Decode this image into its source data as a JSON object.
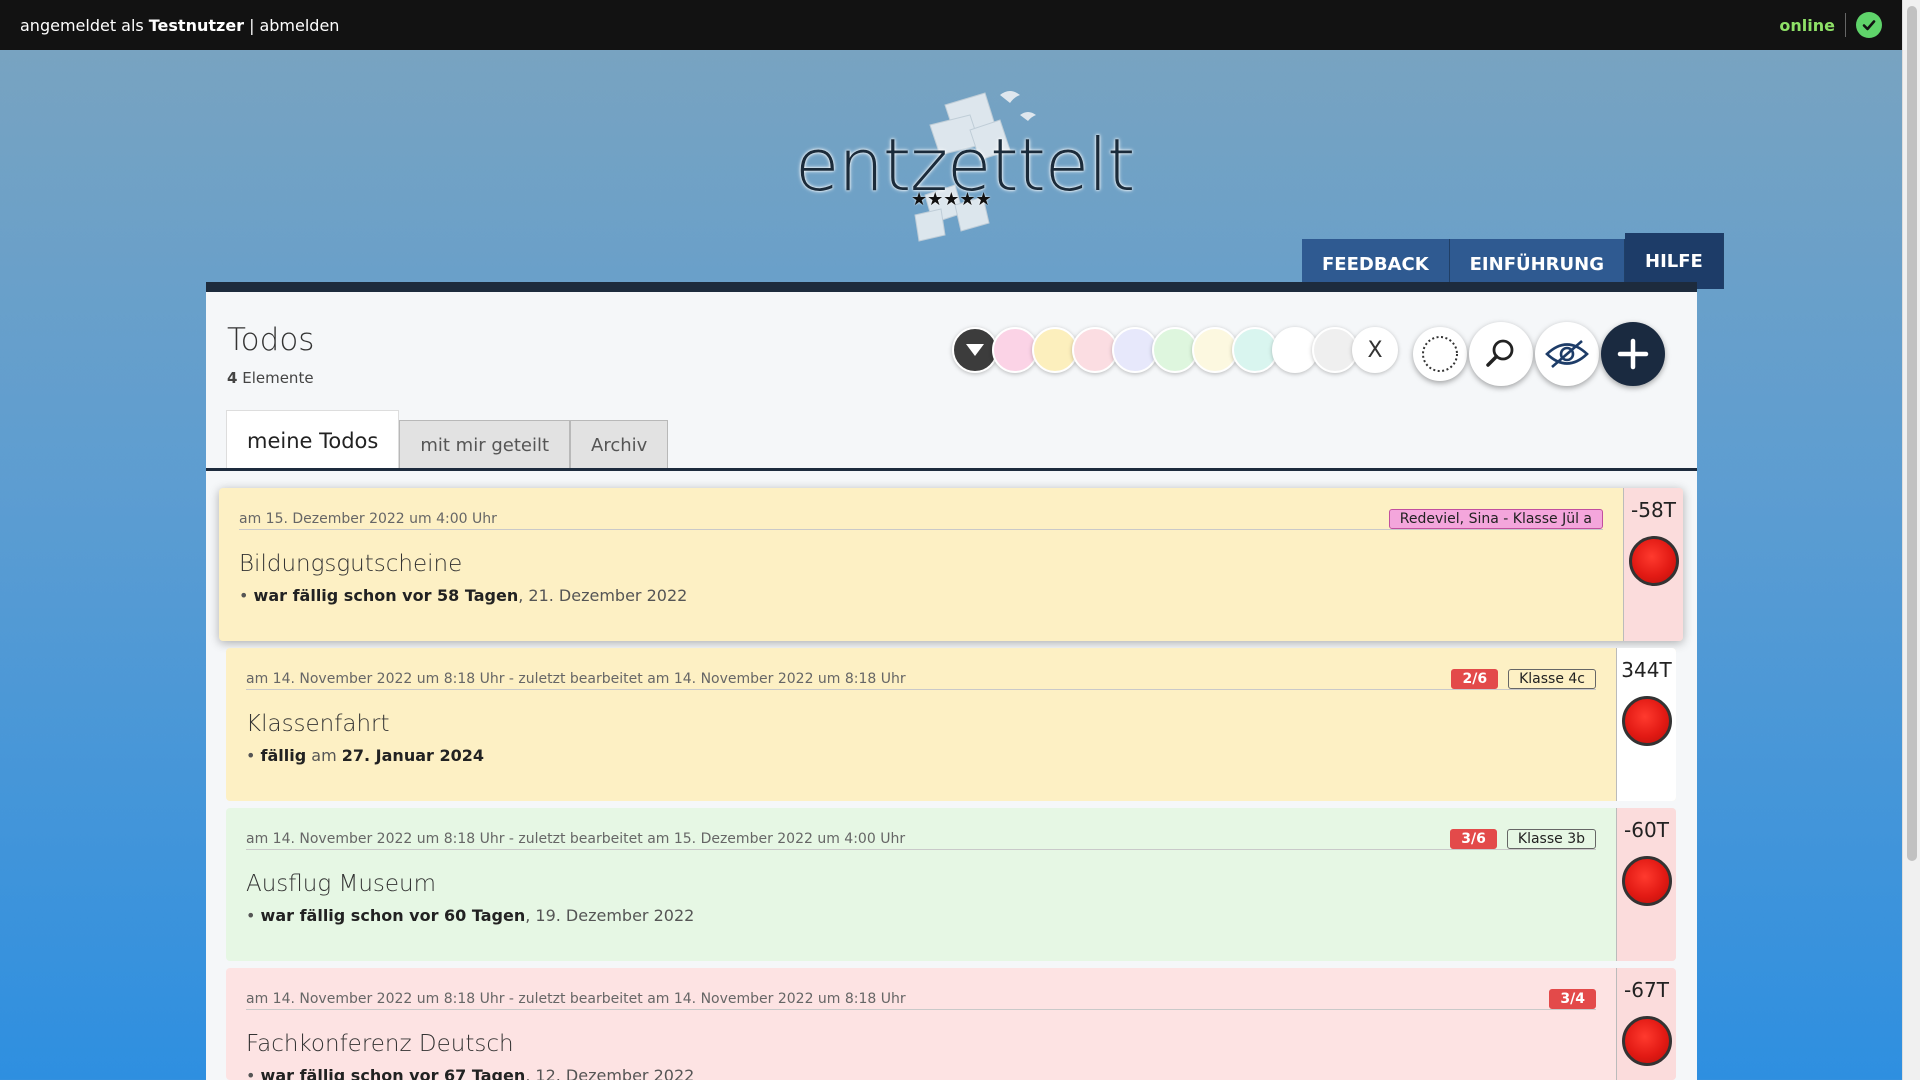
{
  "topbar": {
    "logged_in_prefix": "angemeldet als",
    "username": "Testnutzer",
    "separator": "|",
    "logout": "abmelden",
    "status": "online"
  },
  "logo": {
    "text": "entzettelt",
    "stars": "★★★★★"
  },
  "nav": {
    "feedback": "FEEDBACK",
    "intro": "EINFÜHRUNG",
    "help": "HILFE"
  },
  "panel": {
    "title": "Todos",
    "count": "4",
    "count_label": "Elemente"
  },
  "filters": {
    "colors": [
      "#fbd3e6",
      "#fcefbd",
      "#fbdde2",
      "#e7e8fb",
      "#def6de",
      "#fcf8e0",
      "#d9f5ef",
      "#ffffff",
      "#efefef"
    ],
    "clear_label": "X"
  },
  "tabs": {
    "mine": "meine Todos",
    "shared": "mit mir geteilt",
    "archive": "Archiv"
  },
  "todos": [
    {
      "meta": "am 15. Dezember 2022 um 4:00 Uhr",
      "badges": [
        {
          "type": "pink",
          "label": "Redeviel, Sina - Klasse Jül a"
        }
      ],
      "title": "Bildungsgutscheine",
      "due_bold": "war fällig schon vor 58 Tagen",
      "due_rest": ", 21. Dezember 2022",
      "days": "-58T",
      "bg": "#fdf0c4",
      "side_bg": "#fbdcdc"
    },
    {
      "meta": "am 14. November 2022 um 8:18 Uhr - zuletzt bearbeitet am 14. November 2022 um 8:18 Uhr",
      "badges": [
        {
          "type": "count",
          "label": "2/6"
        },
        {
          "type": "plain",
          "label": "Klasse 4c"
        }
      ],
      "title": "Klassenfahrt",
      "due_bold": "fällig",
      "due_mid": " am ",
      "due_bold2": "27. Januar 2024",
      "days": "344T",
      "bg": "#fdf0c4",
      "side_bg": "#ffffff"
    },
    {
      "meta": "am 14. November 2022 um 8:18 Uhr - zuletzt bearbeitet am 15. Dezember 2022 um 4:00 Uhr",
      "badges": [
        {
          "type": "count",
          "label": "3/6"
        },
        {
          "type": "plain",
          "label": "Klasse 3b"
        }
      ],
      "title": "Ausflug Museum",
      "due_bold": "war fällig schon vor 60 Tagen",
      "due_rest": ", 19. Dezember 2022",
      "days": "-60T",
      "bg": "#e6f7e4",
      "side_bg": "#fbdcdc"
    },
    {
      "meta": "am 14. November 2022 um 8:18 Uhr - zuletzt bearbeitet am 14. November 2022 um 8:18 Uhr",
      "badges": [
        {
          "type": "count",
          "label": "3/4"
        }
      ],
      "title": "Fachkonferenz Deutsch",
      "due_bold": "war fällig schon vor 67 Tagen",
      "due_rest": ", 12. Dezember 2022",
      "days": "-67T",
      "bg": "#fde3e3",
      "side_bg": "#fbdcdc"
    }
  ]
}
